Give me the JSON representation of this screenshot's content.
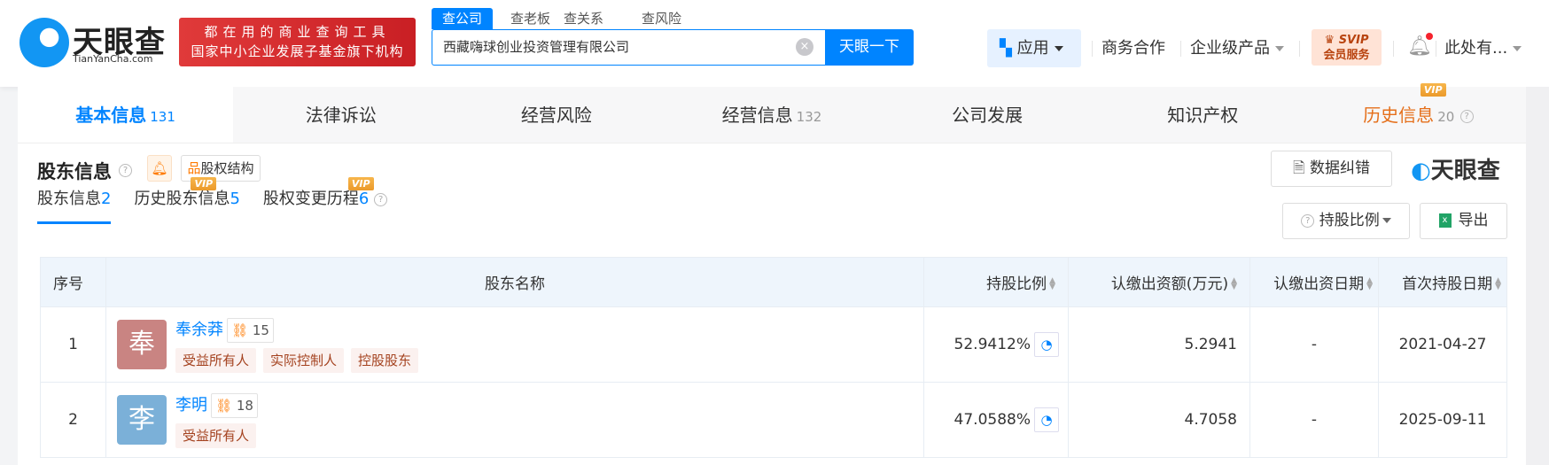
{
  "header": {
    "logo": "天眼查",
    "logo_sub": "TianYanCha.com",
    "banner_line1": "都在用的商业查询工具",
    "banner_line2": "国家中小企业发展子基金旗下机构",
    "search_tabs": [
      "查公司",
      "查老板",
      "查关系",
      "查风险"
    ],
    "search_value": "西藏嗨球创业投资管理有限公司",
    "search_button": "天眼一下",
    "nav": {
      "apps": "应用",
      "business": "商务合作",
      "enterprise": "企业级产品",
      "svip_top": "SVIP",
      "svip_bottom": "会员服务",
      "user": "此处有..."
    }
  },
  "main_tabs": [
    {
      "label": "基本信息",
      "count": "131"
    },
    {
      "label": "法律诉讼"
    },
    {
      "label": "经营风险"
    },
    {
      "label": "经营信息",
      "count": "132"
    },
    {
      "label": "公司发展"
    },
    {
      "label": "知识产权"
    },
    {
      "label": "历史信息",
      "count": "20",
      "badge": "VIP"
    }
  ],
  "section": {
    "title": "股东信息",
    "equity_structure": "股权结构",
    "report_error": "数据纠错",
    "brand": "天眼查",
    "sub_tabs": [
      {
        "label": "股东信息",
        "count": "2"
      },
      {
        "label": "历史股东信息",
        "count": "5",
        "badge": "VIP"
      },
      {
        "label": "股权变更历程",
        "count": "6",
        "badge": "VIP"
      }
    ],
    "ratio_dropdown": "持股比例",
    "export": "导出"
  },
  "table": {
    "columns": [
      "序号",
      "股东名称",
      "持股比例",
      "认缴出资额(万元)",
      "认缴出资日期",
      "首次持股日期"
    ],
    "rows": [
      {
        "index": "1",
        "avatar": "奉",
        "avatar_color": "#c98482",
        "name": "奉余莽",
        "related": "15",
        "tags": [
          "受益所有人",
          "实际控制人",
          "控股股东"
        ],
        "ratio": "52.9412%",
        "amount": "5.2941",
        "sub_date": "-",
        "first_date": "2021-04-27"
      },
      {
        "index": "2",
        "avatar": "李",
        "avatar_color": "#7bb0d8",
        "name": "李明",
        "related": "18",
        "tags": [
          "受益所有人"
        ],
        "ratio": "47.0588%",
        "amount": "4.7058",
        "sub_date": "-",
        "first_date": "2025-09-11"
      }
    ]
  }
}
